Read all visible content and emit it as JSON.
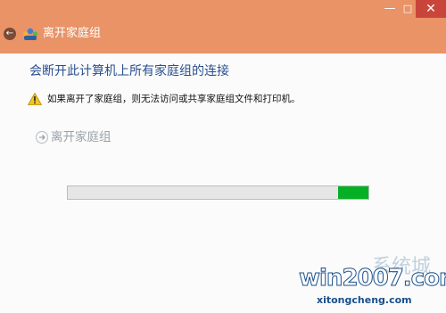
{
  "window": {
    "title": "离开家庭组",
    "controls": {
      "minimize": "—",
      "maximize": "□",
      "close": "✕"
    },
    "back_icon": "arrow-left-icon",
    "title_icon": "homegroup-icon"
  },
  "main": {
    "heading": "会断开此计算机上所有家庭组的连接",
    "warning_icon": "warning-triangle-icon",
    "warning_text": "如果离开了家庭组，则无法访问或共享家庭组文件和打印机。",
    "leave_link": {
      "icon": "arrow-right-icon",
      "label": "离开家庭组"
    },
    "progress": {
      "fill_fraction": 0.1,
      "color": "#06b025"
    }
  },
  "watermark": {
    "main": "win2007.com",
    "chars": "系统城",
    "sub": "xitongcheng.com"
  },
  "colors": {
    "titlebar": "#e99367",
    "heading": "#2a4f8f",
    "close_button": "#c9453a"
  }
}
